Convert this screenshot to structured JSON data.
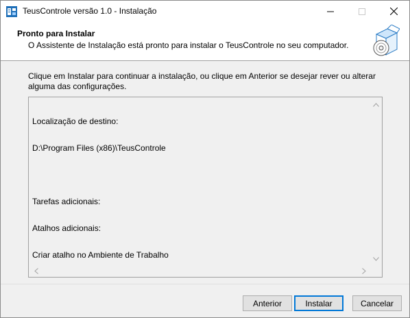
{
  "window": {
    "title": "TeusControle versão 1.0 - Instalação"
  },
  "header": {
    "title": "Pronto para Instalar",
    "subtitle": "O Assistente de Instalação está pronto para instalar o TeusControle no seu computador."
  },
  "body": {
    "instructions": "Clique em Instalar para continuar a instalação, ou clique em Anterior se desejar rever ou alterar alguma das configurações."
  },
  "memo": {
    "lines": [
      "Localização de destino:",
      "      D:\\Program Files (x86)\\TeusControle",
      "",
      "Tarefas adicionais:",
      "      Atalhos adicionais:",
      "         Criar atalho no Ambiente de Trabalho"
    ]
  },
  "buttons": {
    "back": "Anterior",
    "install": "Instalar",
    "cancel": "Cancelar"
  },
  "icons": {
    "app": "installer-app-icon",
    "header": "software-box-disc-icon",
    "minimize": "minimize-icon",
    "maximize": "maximize-icon",
    "close": "close-icon"
  },
  "colors": {
    "accent": "#0078d7",
    "header_bg": "#ffffff",
    "window_bg": "#f0f0f0"
  }
}
